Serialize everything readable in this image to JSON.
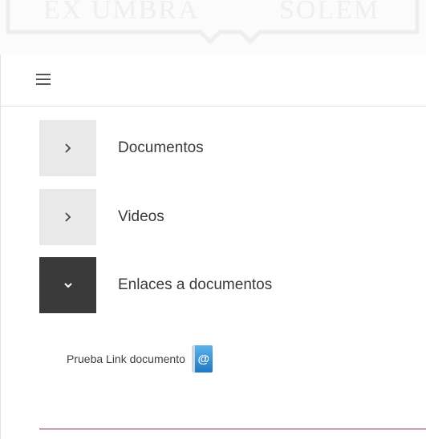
{
  "header": {
    "seal_left": "EX UMBRA",
    "seal_right": "SOLEM"
  },
  "topbar": {
    "menu_icon": "hamburger-icon"
  },
  "menu": {
    "items": [
      {
        "label": "Documentos",
        "state": "collapsed",
        "icon": "chevron-right-icon"
      },
      {
        "label": "Videos",
        "state": "collapsed",
        "icon": "chevron-right-icon"
      },
      {
        "label": "Enlaces a documentos",
        "state": "expanded",
        "icon": "chevron-down-icon"
      }
    ],
    "sublinks": [
      {
        "label": "Prueba Link documento",
        "icon": "email-at-icon",
        "icon_text": "@"
      }
    ]
  },
  "colors": {
    "toggle_collapsed": "#e9e9e9",
    "toggle_expanded": "#3a3a3a",
    "divider": "#8a2a3c",
    "link_icon": "#1f78c4"
  }
}
